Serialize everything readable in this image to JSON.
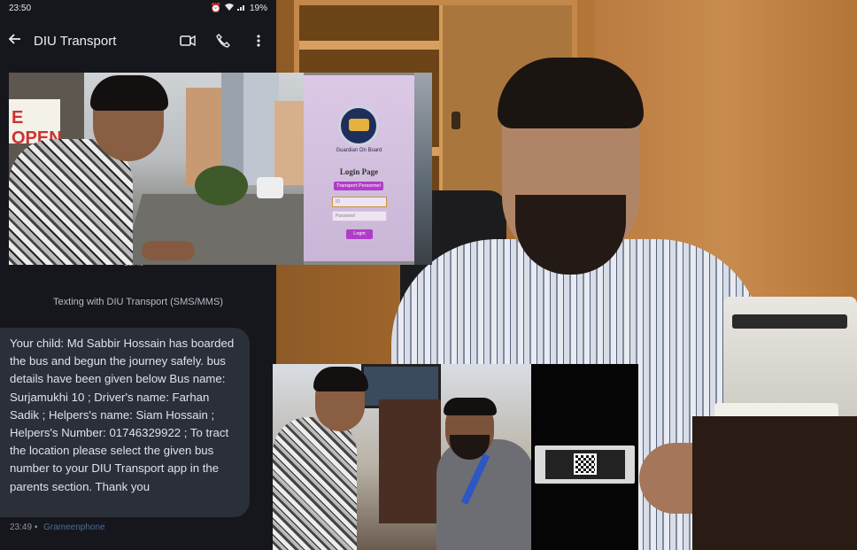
{
  "phone": {
    "status": {
      "time": "23:50",
      "battery": "19%"
    },
    "appbar": {
      "title": "DIU Transport"
    },
    "top_timestamp": "23:49",
    "texting_label": "Texting with DIU Transport (SMS/MMS)",
    "message": {
      "text": "Your child: Md Sabbir Hossain  has boarded the bus and begun the journey safely. bus details have been given below Bus name: Surjamukhi 10 ;   Driver's name: Farhan Sadik ;   Helpers's name: Siam Hossain ;   Helpers's Number: 01746329922 ;  To tract the location please select the given bus number to your DIU Transport app in the parents section. Thank you",
      "time": "23:49",
      "carrier": "Grameenphone"
    }
  },
  "login_screen": {
    "logo_text": "Guardian On Board",
    "heading": "Login Page",
    "role_button": "Transport Personnel",
    "id_placeholder": "ID",
    "password_placeholder": "Password",
    "login_button": "Login"
  },
  "street": {
    "sign_text": "E OPEN"
  },
  "icons": {
    "back": "arrow-left-icon",
    "video": "video-call-icon",
    "phone": "phone-icon",
    "more": "more-vert-icon"
  }
}
